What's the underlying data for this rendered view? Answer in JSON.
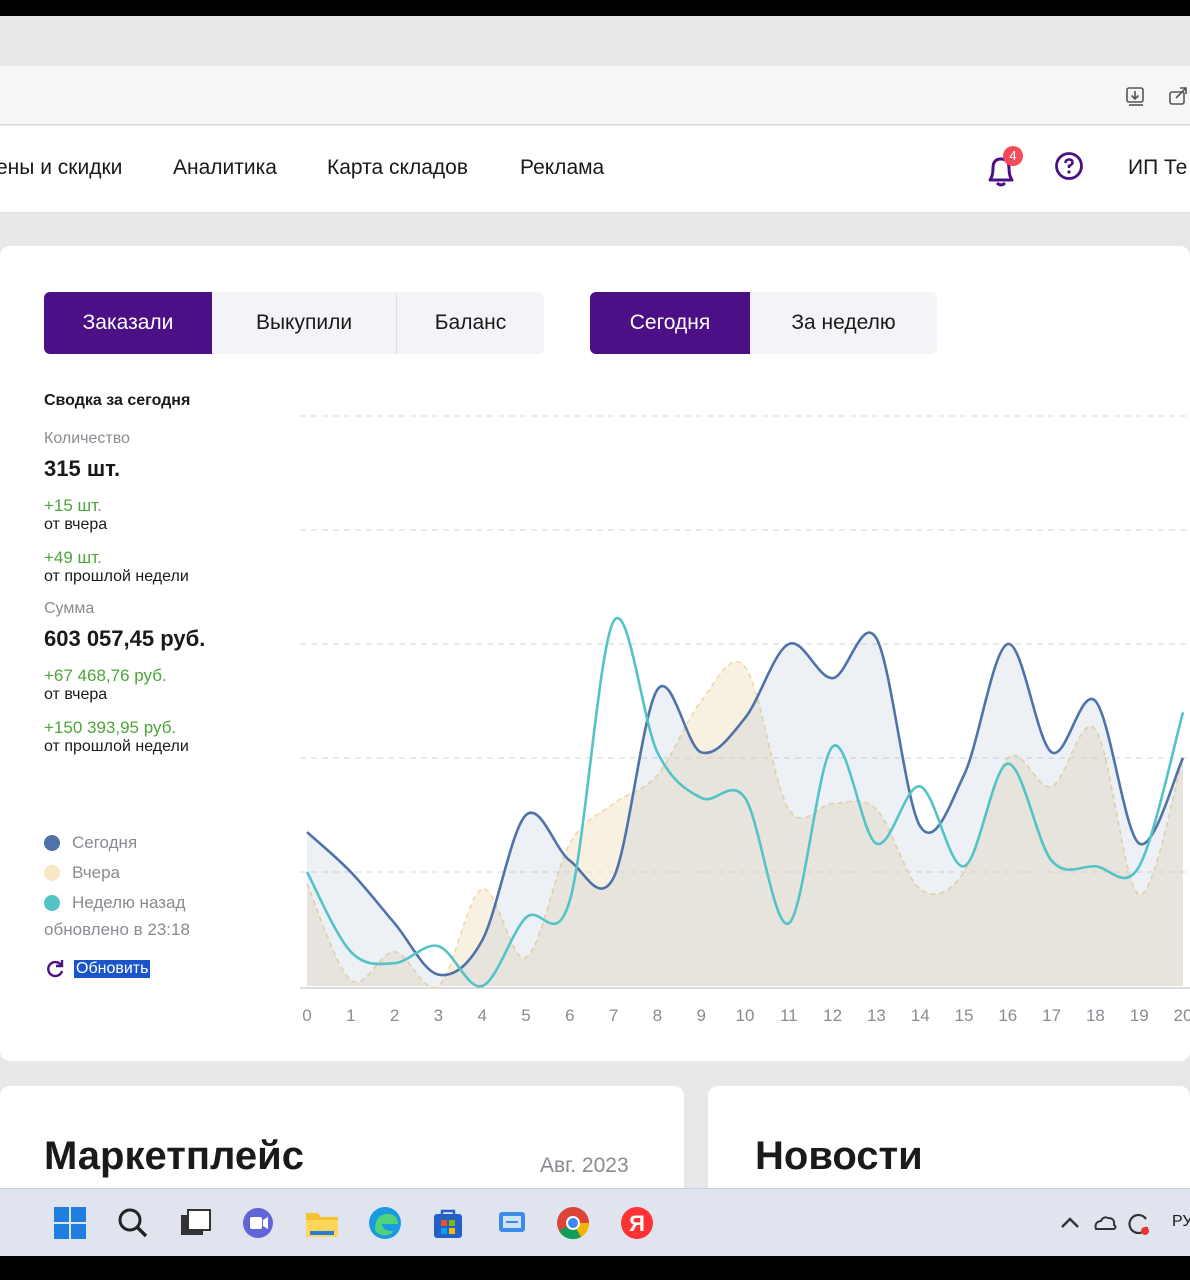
{
  "nav": {
    "items": [
      "ены и скидки",
      "Аналитика",
      "Карта складов",
      "Реклама"
    ],
    "notifications_count": "4",
    "user_label": "ИП Те"
  },
  "tabs": {
    "metric": [
      "Заказали",
      "Выкупили",
      "Баланс"
    ],
    "period": [
      "Сегодня",
      "За неделю"
    ],
    "active_metric": "Заказали",
    "active_period": "Сегодня"
  },
  "summary": {
    "title": "Сводка за сегодня",
    "qty_label": "Количество",
    "qty_value": "315 шт.",
    "qty_delta_yesterday": "+15 шт.",
    "from_yesterday": "от вчера",
    "qty_delta_week": "+49 шт.",
    "from_last_week": "от прошлой недели",
    "sum_label": "Сумма",
    "sum_value": "603 057,45 руб.",
    "sum_delta_yesterday": "+67 468,76 руб.",
    "sum_delta_week": "+150 393,95 руб.",
    "updated": "обновлено в 23:18",
    "refresh": "Обновить"
  },
  "legend": [
    {
      "label": "Сегодня",
      "color": "#4f72a8"
    },
    {
      "label": "Вчера",
      "color": "#f7e7c4"
    },
    {
      "label": "Неделю назад",
      "color": "#54c3c7"
    }
  ],
  "chart_data": {
    "type": "line",
    "x": [
      0,
      1,
      2,
      3,
      4,
      5,
      6,
      7,
      8,
      9,
      10,
      11,
      12,
      13,
      14,
      15,
      16,
      17,
      18,
      19,
      20
    ],
    "y_range": [
      0,
      5
    ],
    "grid": "horizontal dashed",
    "series": [
      {
        "name": "Сегодня",
        "color": "#4f72a8",
        "values": [
          1.35,
          1.0,
          0.55,
          0.1,
          0.4,
          1.5,
          1.1,
          0.95,
          2.6,
          2.05,
          2.35,
          3.0,
          2.7,
          3.05,
          1.4,
          1.85,
          3.0,
          2.05,
          2.5,
          1.25,
          2.0
        ]
      },
      {
        "name": "Вчера",
        "color": "#f7e7c4",
        "values": [
          0.9,
          0.05,
          0.3,
          0.0,
          0.85,
          0.25,
          1.25,
          1.6,
          1.85,
          2.5,
          2.8,
          1.55,
          1.6,
          1.55,
          0.85,
          1.0,
          2.0,
          1.75,
          2.25,
          0.8,
          2.0
        ]
      },
      {
        "name": "Неделю назад",
        "color": "#54c3c7",
        "values": [
          1.0,
          0.3,
          0.2,
          0.35,
          0.0,
          0.6,
          0.75,
          3.2,
          2.05,
          1.65,
          1.65,
          0.55,
          2.1,
          1.25,
          1.75,
          1.05,
          1.95,
          1.1,
          1.05,
          1.05,
          2.4
        ]
      }
    ]
  },
  "bottom": {
    "marketplace_title": "Маркетплейс",
    "marketplace_date": "Авг. 2023",
    "news_title": "Новости"
  },
  "taskbar": {
    "lang": "РУ"
  }
}
